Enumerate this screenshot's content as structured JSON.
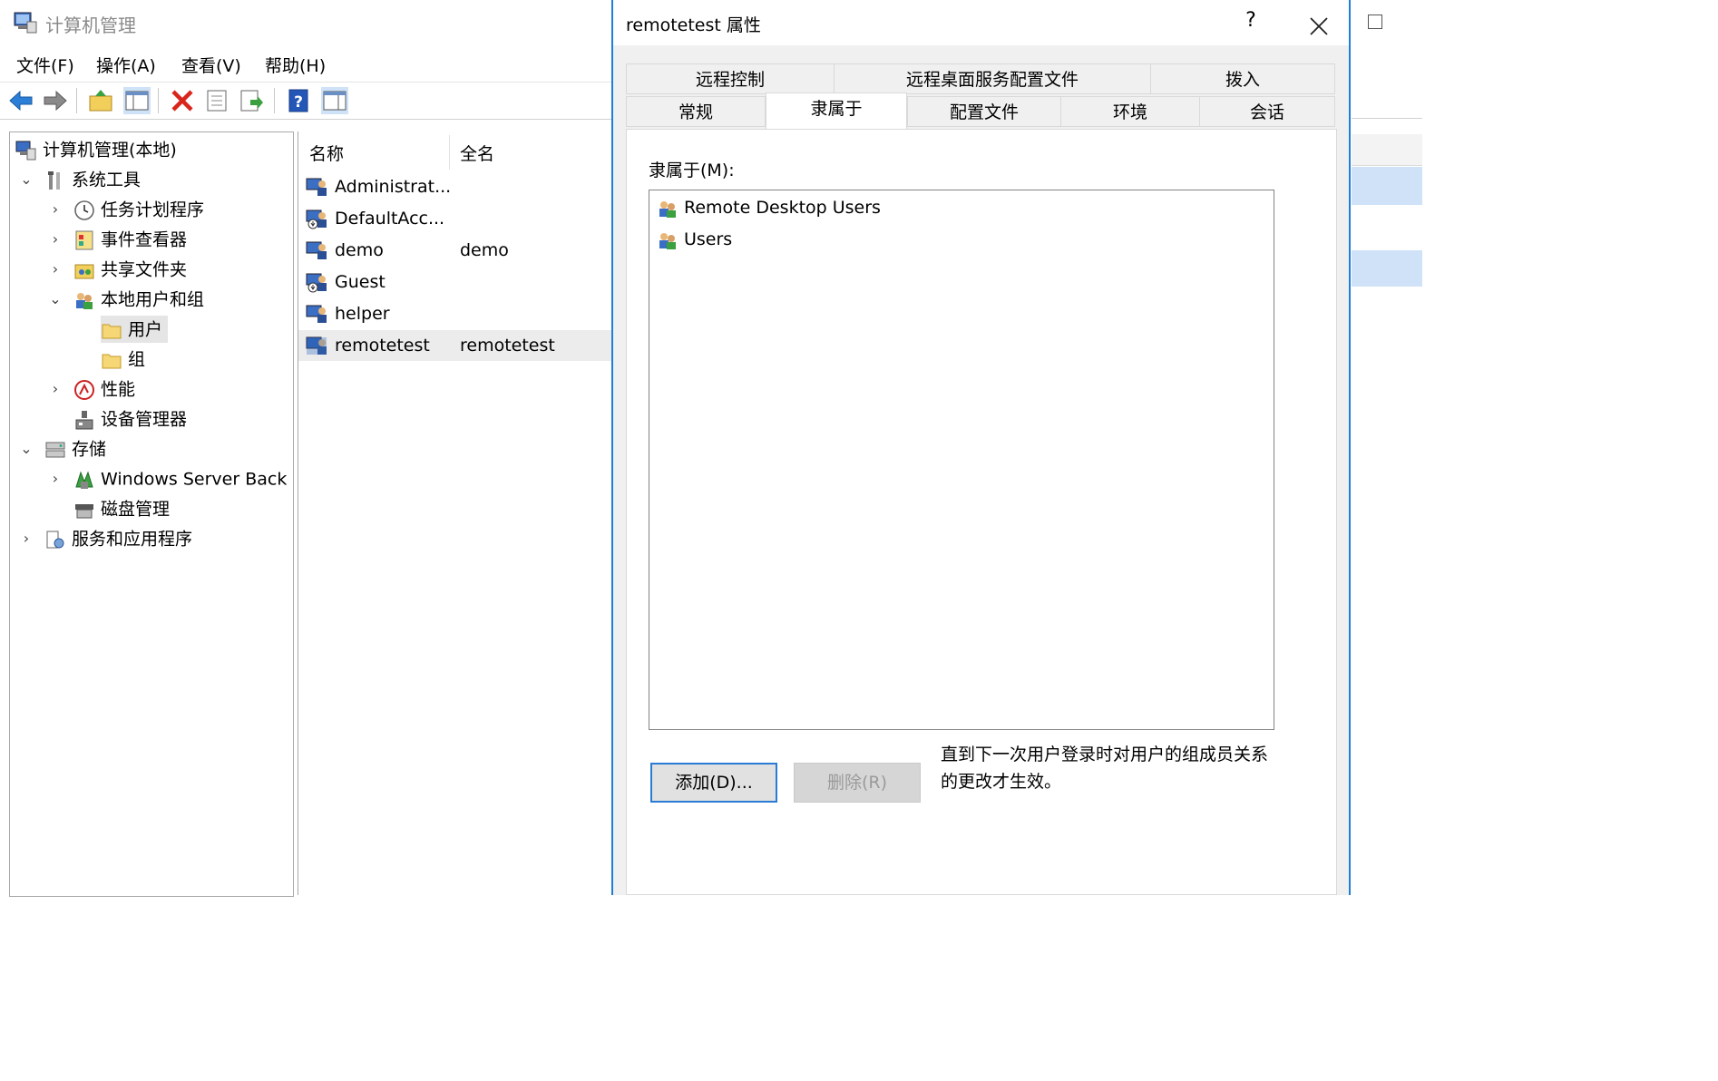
{
  "app": {
    "title": "计算机管理"
  },
  "menu": {
    "items": [
      "文件(F)",
      "操作(A)",
      "查看(V)",
      "帮助(H)"
    ]
  },
  "tree": {
    "root": "计算机管理(本地)",
    "system_tools": "系统工具",
    "task_scheduler": "任务计划程序",
    "event_viewer": "事件查看器",
    "shared_folders": "共享文件夹",
    "local_users_groups": "本地用户和组",
    "users": "用户",
    "groups": "组",
    "performance": "性能",
    "device_manager": "设备管理器",
    "storage": "存储",
    "windows_server_backup": "Windows Server Back",
    "disk_management": "磁盘管理",
    "services_apps": "服务和应用程序"
  },
  "list": {
    "columns": {
      "name": "名称",
      "fullname": "全名"
    },
    "rows": [
      {
        "name": "Administrat...",
        "fullname": ""
      },
      {
        "name": "DefaultAcc...",
        "fullname": ""
      },
      {
        "name": "demo",
        "fullname": "demo"
      },
      {
        "name": "Guest",
        "fullname": ""
      },
      {
        "name": "helper",
        "fullname": ""
      },
      {
        "name": "remotetest",
        "fullname": "remotetest"
      }
    ]
  },
  "dialog": {
    "title": "remotetest 属性",
    "help": "?",
    "tabs_row1": [
      "远程控制",
      "远程桌面服务配置文件",
      "拨入"
    ],
    "tabs_row2": [
      "常规",
      "隶属于",
      "配置文件",
      "环境",
      "会话"
    ],
    "memberof_label": "隶属于(M):",
    "members": [
      "Remote Desktop Users",
      "Users"
    ],
    "add_label": "添加(D)...",
    "remove_label": "删除(R)",
    "note": "直到下一次用户登录时对用户的组成员关系的更改才生效。"
  },
  "colors": {
    "accent": "#1e7fd8",
    "selection": "#cfe2f7"
  }
}
